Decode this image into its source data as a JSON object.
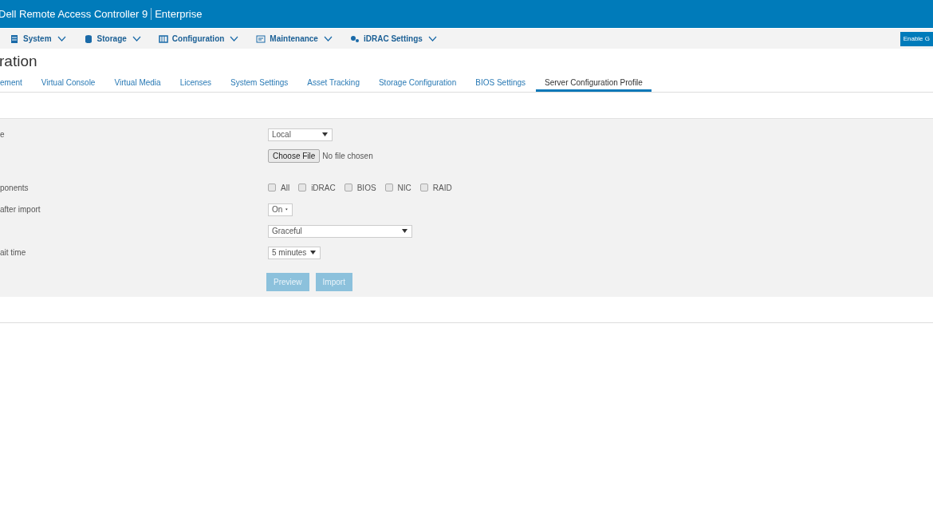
{
  "header": {
    "product": "Dell Remote Access Controller 9",
    "edition": "Enterprise"
  },
  "nav": {
    "items": [
      {
        "label": "System"
      },
      {
        "label": "Storage"
      },
      {
        "label": "Configuration"
      },
      {
        "label": "Maintenance"
      },
      {
        "label": "iDRAC Settings"
      }
    ],
    "action": "Enable G"
  },
  "page_title": "ration",
  "tabs": [
    {
      "label": "ement",
      "selected": false
    },
    {
      "label": "Virtual Console",
      "selected": false
    },
    {
      "label": "Virtual Media",
      "selected": false
    },
    {
      "label": "Licenses",
      "selected": false
    },
    {
      "label": "System Settings",
      "selected": false
    },
    {
      "label": "Asset Tracking",
      "selected": false
    },
    {
      "label": "Storage Configuration",
      "selected": false
    },
    {
      "label": "BIOS Settings",
      "selected": false
    },
    {
      "label": "Server Configuration Profile",
      "selected": true
    }
  ],
  "form": {
    "rows": [
      {
        "kind": "select",
        "label": "e",
        "value": "Local"
      },
      {
        "kind": "file",
        "button": "Choose File",
        "status": "No file chosen"
      },
      {
        "kind": "checks",
        "label": "ponents",
        "options": [
          {
            "label": "All",
            "checked": false
          },
          {
            "label": "iDRAC",
            "checked": false
          },
          {
            "label": "BIOS",
            "checked": false
          },
          {
            "label": "NIC",
            "checked": false
          },
          {
            "label": "RAID",
            "checked": false
          }
        ]
      },
      {
        "kind": "select",
        "label": "after import",
        "value": "On"
      },
      {
        "kind": "select",
        "value": "Graceful"
      },
      {
        "kind": "select",
        "label": "ait time",
        "value": "5 minutes"
      },
      {
        "kind": "buttons",
        "buttons": [
          {
            "label": "Preview",
            "disabled": true
          },
          {
            "label": "Import",
            "disabled": true
          }
        ]
      }
    ]
  }
}
